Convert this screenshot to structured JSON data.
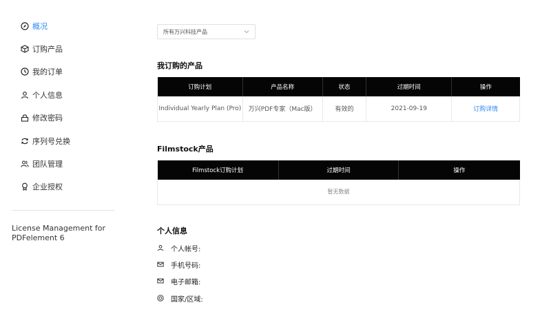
{
  "sidebar": {
    "items": [
      {
        "label": "概况",
        "icon": "compass-icon",
        "active": true
      },
      {
        "label": "订购产品",
        "icon": "box-icon"
      },
      {
        "label": "我的订单",
        "icon": "clock-icon"
      },
      {
        "label": "个人信息",
        "icon": "user-icon"
      },
      {
        "label": "修改密码",
        "icon": "lock-icon"
      },
      {
        "label": "序列号兑换",
        "icon": "exchange-icon"
      },
      {
        "label": "团队管理",
        "icon": "team-icon"
      },
      {
        "label": "企业授权",
        "icon": "award-icon"
      }
    ],
    "license_text": "License Management for PDFelement 6"
  },
  "filter": {
    "selected": "所有万兴科技产品"
  },
  "orders": {
    "title": "我订购的产品",
    "columns": [
      "订购计划",
      "产品名称",
      "状态",
      "过期时间",
      "操作"
    ],
    "rows": [
      {
        "plan": "Individual Yearly Plan (Pro)",
        "product": "万兴PDF专家（Mac版）",
        "status": "有效的",
        "expires": "2021-09-19",
        "action": "订购详情"
      }
    ]
  },
  "filmstock": {
    "title": "Filmstock产品",
    "columns": [
      "Filmstock订购计划",
      "过期时间",
      "操作"
    ],
    "empty_text": "暂无数据"
  },
  "personal": {
    "title": "个人信息",
    "fields": [
      {
        "label": "个人帐号:",
        "icon": "user-icon"
      },
      {
        "label": "手机号码:",
        "icon": "mail-icon"
      },
      {
        "label": "电子邮箱:",
        "icon": "mail-icon"
      },
      {
        "label": "国家/区域:",
        "icon": "globe-icon"
      }
    ]
  },
  "colors": {
    "accent": "#2e8af5",
    "header_bg": "#050505"
  }
}
